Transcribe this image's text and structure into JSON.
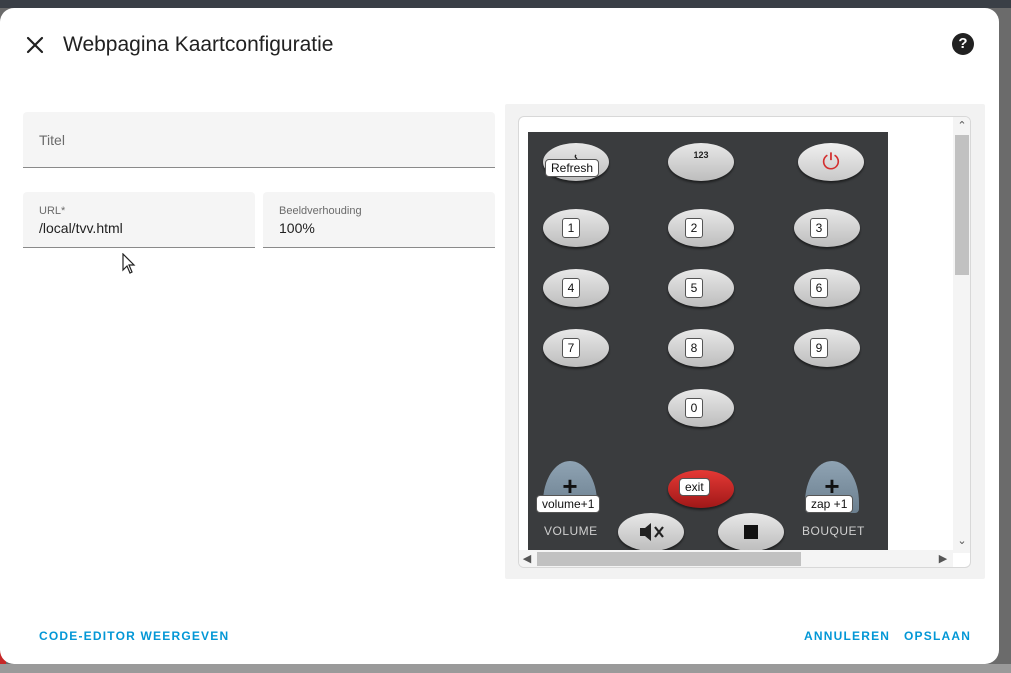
{
  "dialog": {
    "title": "Webpagina Kaartconfiguratie",
    "help_glyph": "?"
  },
  "form": {
    "title_field": {
      "label": "Titel",
      "value": ""
    },
    "url_field": {
      "label": "URL*",
      "value": "/local/tvv.html"
    },
    "aspect_field": {
      "label": "Beeldverhouding",
      "value": "100%"
    }
  },
  "preview": {
    "remote": {
      "top_buttons": [
        {
          "name": "wifi-icon",
          "glyph": "⌇"
        },
        {
          "name": "numpad-icon",
          "glyph": "123"
        },
        {
          "name": "power-icon",
          "glyph": "⏻"
        }
      ],
      "tooltips": {
        "refresh": "Refresh",
        "exit": "exit",
        "volume_up": "volume+1",
        "zap_up": "zap +1"
      },
      "number_keys": [
        "1",
        "2",
        "3",
        "4",
        "5",
        "6",
        "7",
        "8",
        "9",
        "0"
      ],
      "labels": {
        "volume": "VOLUME",
        "bouquet": "BOUQUET"
      },
      "bottom_icons": [
        "mute-icon",
        "stop-icon"
      ]
    }
  },
  "footer": {
    "code_editor": "CODE-EDITOR WEERGEVEN",
    "cancel": "ANNULEREN",
    "save": "OPSLAAN"
  },
  "colors": {
    "accent": "#0397d6",
    "remote_bg": "#3a3c3e",
    "exit_red": "#d32f2f"
  }
}
